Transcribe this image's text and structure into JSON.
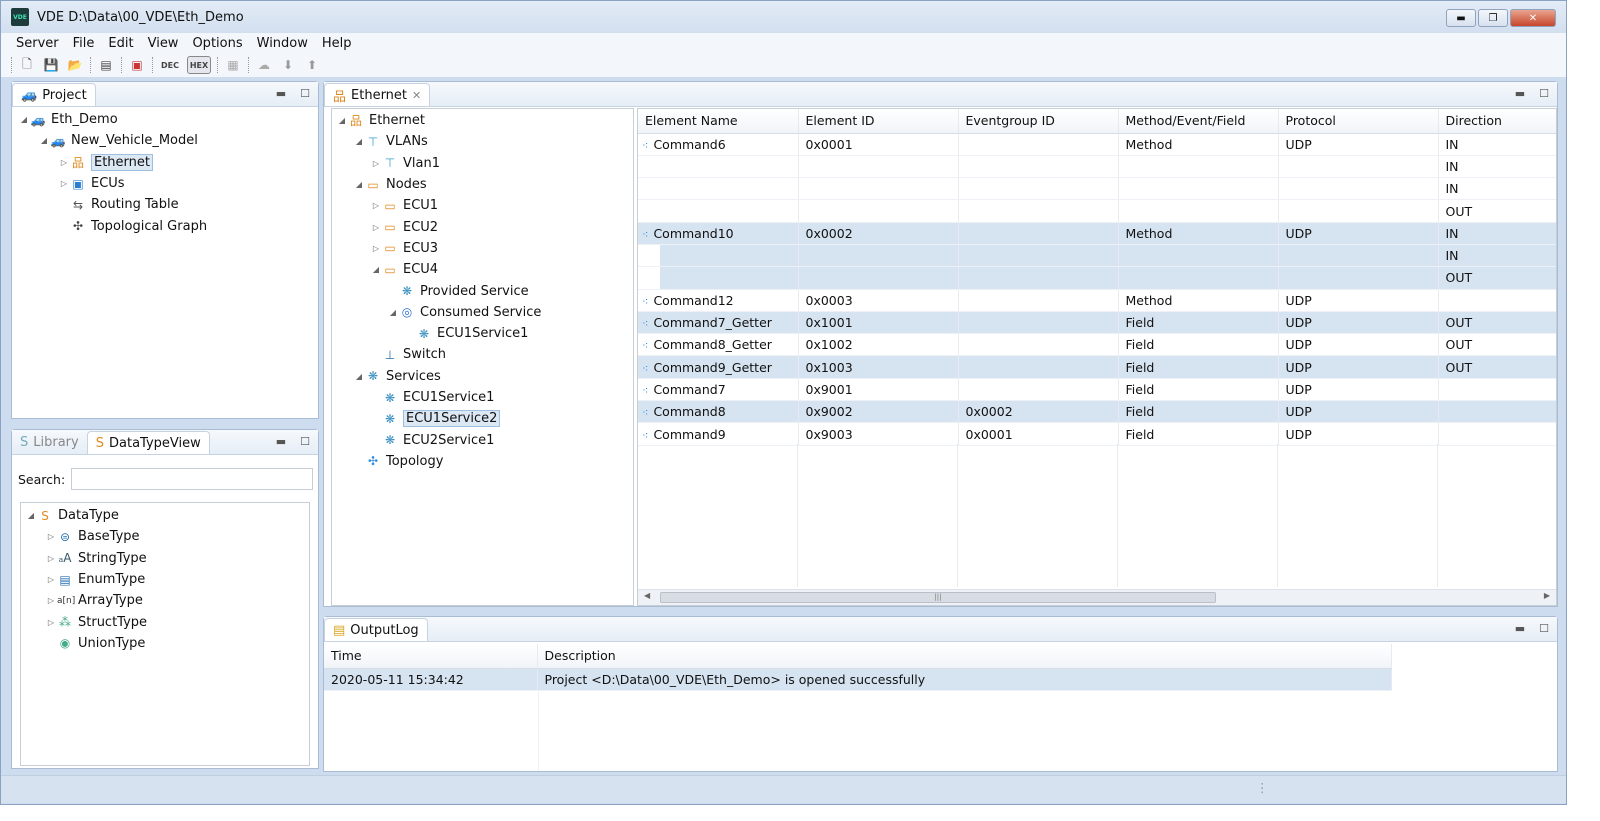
{
  "window": {
    "title": "VDE  D:\\Data\\00_VDE\\Eth_Demo",
    "logo": "VDE"
  },
  "menu": [
    "Server",
    "File",
    "Edit",
    "View",
    "Options",
    "Window",
    "Help"
  ],
  "toolbar": {
    "dec": "DEC",
    "hex": "HEX"
  },
  "project": {
    "tab": "Project",
    "tree": [
      {
        "label": "Eth_Demo",
        "level": 0,
        "tw": "◢",
        "icon": "car-icon"
      },
      {
        "label": "New_Vehicle_Model",
        "level": 1,
        "tw": "◢",
        "icon": "car-icon"
      },
      {
        "label": "Ethernet",
        "level": 2,
        "tw": "▷",
        "icon": "network-icon",
        "selected": true
      },
      {
        "label": "ECUs",
        "level": 2,
        "tw": "▷",
        "icon": "ecu-icon"
      },
      {
        "label": "Routing Table",
        "level": 2,
        "tw": "",
        "icon": "routing-icon"
      },
      {
        "label": "Topological Graph",
        "level": 2,
        "tw": "",
        "icon": "graph-icon"
      }
    ]
  },
  "datatype": {
    "tabs": [
      "Library",
      "DataTypeView"
    ],
    "search_label": "Search:",
    "search_value": "",
    "tree": [
      {
        "label": "DataType",
        "level": 0,
        "tw": "◢",
        "icon": "datatype-icon"
      },
      {
        "label": "BaseType",
        "level": 1,
        "tw": "▷",
        "icon": "basetype-icon"
      },
      {
        "label": "StringType",
        "level": 1,
        "tw": "▷",
        "icon": "stringtype-icon"
      },
      {
        "label": "EnumType",
        "level": 1,
        "tw": "▷",
        "icon": "enumtype-icon"
      },
      {
        "label": "ArrayType",
        "level": 1,
        "tw": "▷",
        "icon": "arraytype-icon"
      },
      {
        "label": "StructType",
        "level": 1,
        "tw": "▷",
        "icon": "structtype-icon"
      },
      {
        "label": "UnionType",
        "level": 1,
        "tw": "",
        "icon": "uniontype-icon"
      }
    ]
  },
  "editor": {
    "tab": "Ethernet",
    "tree": [
      {
        "label": "Ethernet",
        "level": 0,
        "tw": "◢",
        "icon": "network-icon"
      },
      {
        "label": "VLANs",
        "level": 1,
        "tw": "◢",
        "icon": "vlan-icon"
      },
      {
        "label": "Vlan1",
        "level": 2,
        "tw": "▷",
        "icon": "vlan-icon"
      },
      {
        "label": "Nodes",
        "level": 1,
        "tw": "◢",
        "icon": "node-icon"
      },
      {
        "label": "ECU1",
        "level": 2,
        "tw": "▷",
        "icon": "node-icon"
      },
      {
        "label": "ECU2",
        "level": 2,
        "tw": "▷",
        "icon": "node-icon"
      },
      {
        "label": "ECU3",
        "level": 2,
        "tw": "▷",
        "icon": "node-icon"
      },
      {
        "label": "ECU4",
        "level": 2,
        "tw": "◢",
        "icon": "node-icon"
      },
      {
        "label": "Provided Service",
        "level": 3,
        "tw": "",
        "icon": "service-icon"
      },
      {
        "label": "Consumed Service",
        "level": 3,
        "tw": "◢",
        "icon": "consumed-service-icon"
      },
      {
        "label": "ECU1Service1",
        "level": 4,
        "tw": "",
        "icon": "service-icon"
      },
      {
        "label": "Switch",
        "level": 2,
        "tw": "",
        "icon": "switch-icon"
      },
      {
        "label": "Services",
        "level": 1,
        "tw": "◢",
        "icon": "service-icon"
      },
      {
        "label": "ECU1Service1",
        "level": 2,
        "tw": "",
        "icon": "service-icon"
      },
      {
        "label": "ECU1Service2",
        "level": 2,
        "tw": "",
        "icon": "service-icon",
        "selected": true
      },
      {
        "label": "ECU2Service1",
        "level": 2,
        "tw": "",
        "icon": "service-icon"
      },
      {
        "label": "Topology",
        "level": 1,
        "tw": "",
        "icon": "topology-icon"
      }
    ],
    "columns": [
      "Element Name",
      "Element ID",
      "Eventgroup ID",
      "Method/Event/Field",
      "Protocol",
      "Direction"
    ],
    "rows": [
      {
        "cells": [
          "Command6",
          "0x0001",
          "",
          "Method",
          "UDP",
          "IN"
        ]
      },
      {
        "cells": [
          "",
          "",
          "",
          "",
          "",
          "IN"
        ]
      },
      {
        "cells": [
          "",
          "",
          "",
          "",
          "",
          "IN"
        ]
      },
      {
        "cells": [
          "",
          "",
          "",
          "",
          "",
          "OUT"
        ]
      },
      {
        "cells": [
          "Command10",
          "0x0002",
          "",
          "Method",
          "UDP",
          "IN"
        ],
        "hl": true
      },
      {
        "cells": [
          "",
          "",
          "",
          "",
          "",
          "IN"
        ],
        "hl": true
      },
      {
        "cells": [
          "",
          "",
          "",
          "",
          "",
          "OUT"
        ],
        "hl": true
      },
      {
        "cells": [
          "Command12",
          "0x0003",
          "",
          "Method",
          "UDP",
          ""
        ]
      },
      {
        "cells": [
          "Command7_Getter",
          "0x1001",
          "",
          "Field",
          "UDP",
          "OUT"
        ],
        "hl": true
      },
      {
        "cells": [
          "Command8_Getter",
          "0x1002",
          "",
          "Field",
          "UDP",
          "OUT"
        ]
      },
      {
        "cells": [
          "Command9_Getter",
          "0x1003",
          "",
          "Field",
          "UDP",
          "OUT"
        ],
        "hl": true
      },
      {
        "cells": [
          "Command7",
          "0x9001",
          "",
          "Field",
          "UDP",
          ""
        ]
      },
      {
        "cells": [
          "Command8",
          "0x9002",
          "0x0002",
          "Field",
          "UDP",
          ""
        ],
        "hl": true
      },
      {
        "cells": [
          "Command9",
          "0x9003",
          "0x0001",
          "Field",
          "UDP",
          ""
        ]
      }
    ]
  },
  "output": {
    "tab": "OutputLog",
    "columns": [
      "Time",
      "Description"
    ],
    "rows": [
      [
        "2020-05-11 15:34:42",
        "Project <D:\\Data\\00_VDE\\Eth_Demo> is opened successfully"
      ]
    ]
  }
}
